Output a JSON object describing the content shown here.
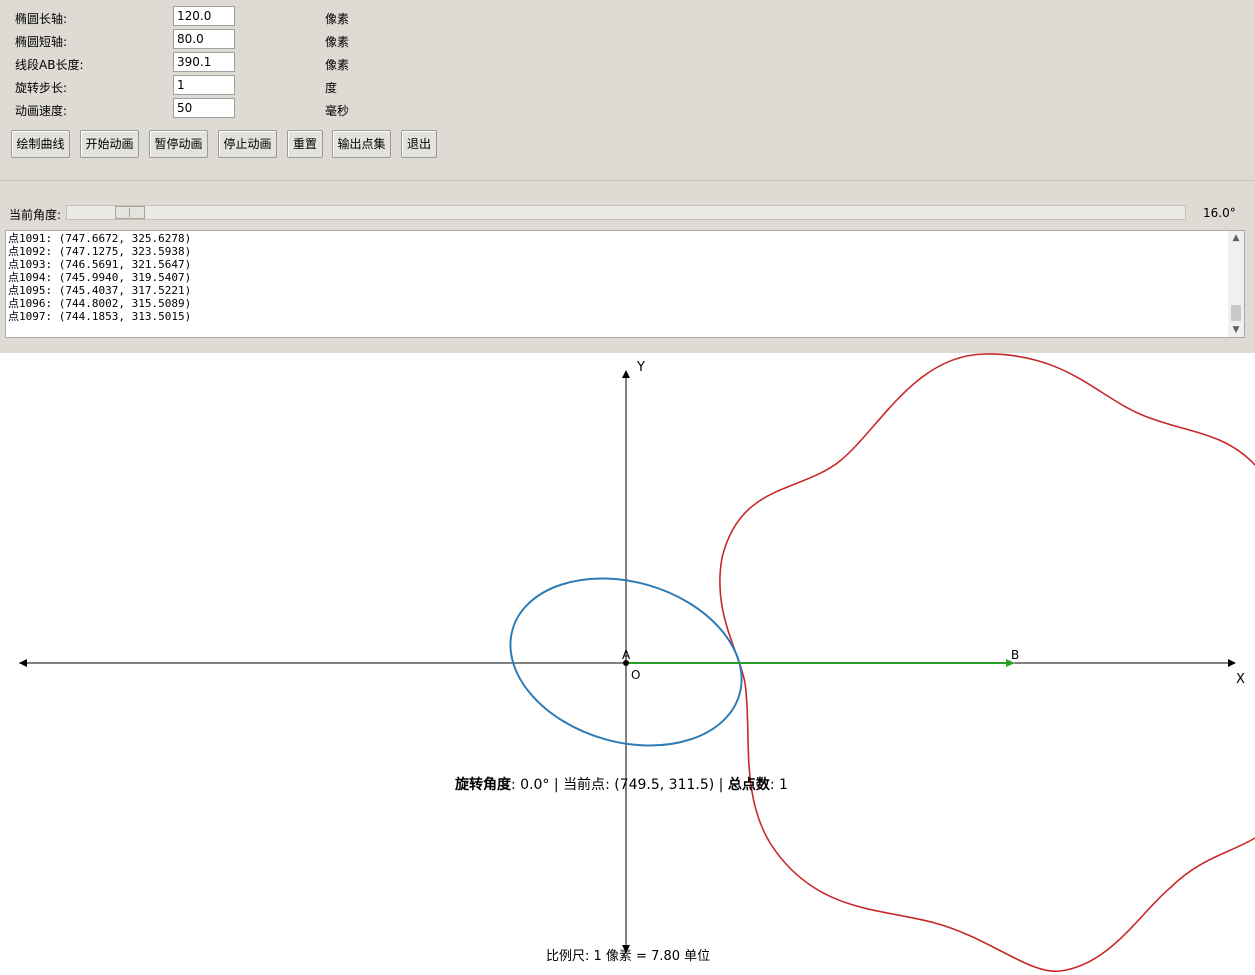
{
  "params": [
    {
      "label": "椭圆长轴:",
      "value": "120.0",
      "unit": "像素"
    },
    {
      "label": "椭圆短轴:",
      "value": "80.0",
      "unit": "像素"
    },
    {
      "label": "线段AB长度:",
      "value": "390.1",
      "unit": "像素"
    },
    {
      "label": "旋转步长:",
      "value": "1",
      "unit": "度"
    },
    {
      "label": "动画速度:",
      "value": "50",
      "unit": "毫秒"
    }
  ],
  "buttons": {
    "draw": "绘制曲线",
    "start": "开始动画",
    "pause": "暂停动画",
    "stop": "停止动画",
    "reset": "重置",
    "export": "输出点集",
    "exit": "退出"
  },
  "slider": {
    "label": "当前角度:",
    "value_text": "16.0°",
    "value_deg": 16.0,
    "max_deg": 360
  },
  "log_lines": [
    "点1091: (747.6672, 325.6278)",
    "点1092: (747.1275, 323.5938)",
    "点1093: (746.5691, 321.5647)",
    "点1094: (745.9940, 319.5407)",
    "点1095: (745.4037, 317.5221)",
    "点1096: (744.8002, 315.5089)",
    "点1097: (744.1853, 313.5015)"
  ],
  "scroll_up_icon": "triangle-up",
  "scroll_down_icon": "triangle-down",
  "canvas": {
    "axis_x_label": "X",
    "axis_y_label": "Y",
    "origin_label": "O",
    "point_a_label": "A",
    "point_b_label": "B",
    "status": {
      "rotation_label": "旋转角度",
      "rotation_value": ": 0.0° | ",
      "current_label": "当前点",
      "current_value": ": (749.5, 311.5) | ",
      "total_label": "总点数",
      "total_value": ": 1"
    },
    "scale_text": "比例尺: 1 像素 = 7.80 单位",
    "colors": {
      "ellipse": "#2e7cb6",
      "curve": "#c8282a",
      "segment": "#2aa02a",
      "axis": "#000000"
    }
  }
}
